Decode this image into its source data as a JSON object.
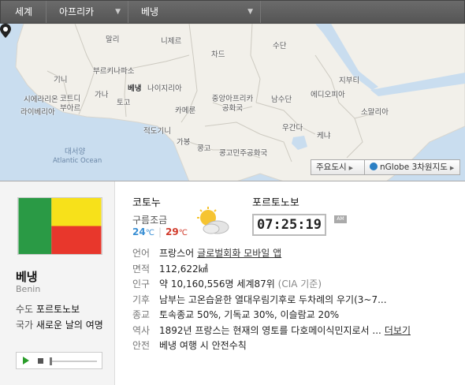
{
  "breadcrumb": {
    "items": [
      "세계",
      "아프리카",
      "베냉"
    ]
  },
  "map": {
    "labels": {
      "mali": "말리",
      "niger": "니제르",
      "chad": "차드",
      "sudan": "수단",
      "burkina": "부르키나파소",
      "benin": "베냉",
      "nigeria": "나이지리아",
      "guinea": "기니",
      "sierra_leone": "시에라리온",
      "liberia": "라이베리아",
      "cote": "코트디부아르",
      "ghana": "가나",
      "togo": "토고",
      "cameroon": "카메룬",
      "car": "중앙아프리카공화국",
      "south_sudan": "남수단",
      "ethiopia": "에디오피아",
      "djibouti": "지부티",
      "somalia": "소말리아",
      "eq_guinea": "적도기니",
      "gabon": "가봉",
      "congo": "콩고",
      "drc": "콩고민주공화국",
      "uganda": "우간다",
      "kenya": "케냐",
      "atlantic_ko": "대서양",
      "atlantic_en": "Atlantic Ocean"
    },
    "buttons": {
      "cities": "주요도시",
      "globe": "nGlobe 3차원지도"
    }
  },
  "country": {
    "name": "베냉",
    "name_en": "Benin",
    "capital_key": "수도",
    "capital": "포르토노보",
    "anthem_key": "국가",
    "anthem": "새로운 날의 여명"
  },
  "weather": {
    "city": "코토누",
    "desc": "구름조금",
    "low": "24",
    "high": "29",
    "unit": "℃"
  },
  "clock": {
    "city": "포르토노보",
    "time": "07:25:19",
    "ampm": "AM"
  },
  "info": [
    {
      "key": "언어",
      "value": "프랑스어",
      "link": "글로벌회화 모바일 앱"
    },
    {
      "key": "면적",
      "value": "112,622㎢"
    },
    {
      "key": "인구",
      "value": "약 10,160,556명 세계87위",
      "muted": "(CIA 기준)"
    },
    {
      "key": "기후",
      "value": "남부는 고온습윤한 열대우림기후로 두차례의 우기(3~7..."
    },
    {
      "key": "종교",
      "value": "토속종교 50%, 기독교 30%, 이슬람교 20%"
    },
    {
      "key": "역사",
      "value": "1892년 프랑스는 현재의 영토를 다호메이식민지로서 ...",
      "link": "더보기"
    },
    {
      "key": "안전",
      "value": "베냉 여행 시 안전수칙"
    }
  ],
  "colors": {
    "flag_green": "#2a9a45",
    "flag_yellow": "#f7e11a",
    "flag_red": "#e8372c",
    "temp_low": "#3a8fd4",
    "temp_high": "#d13b2c"
  }
}
